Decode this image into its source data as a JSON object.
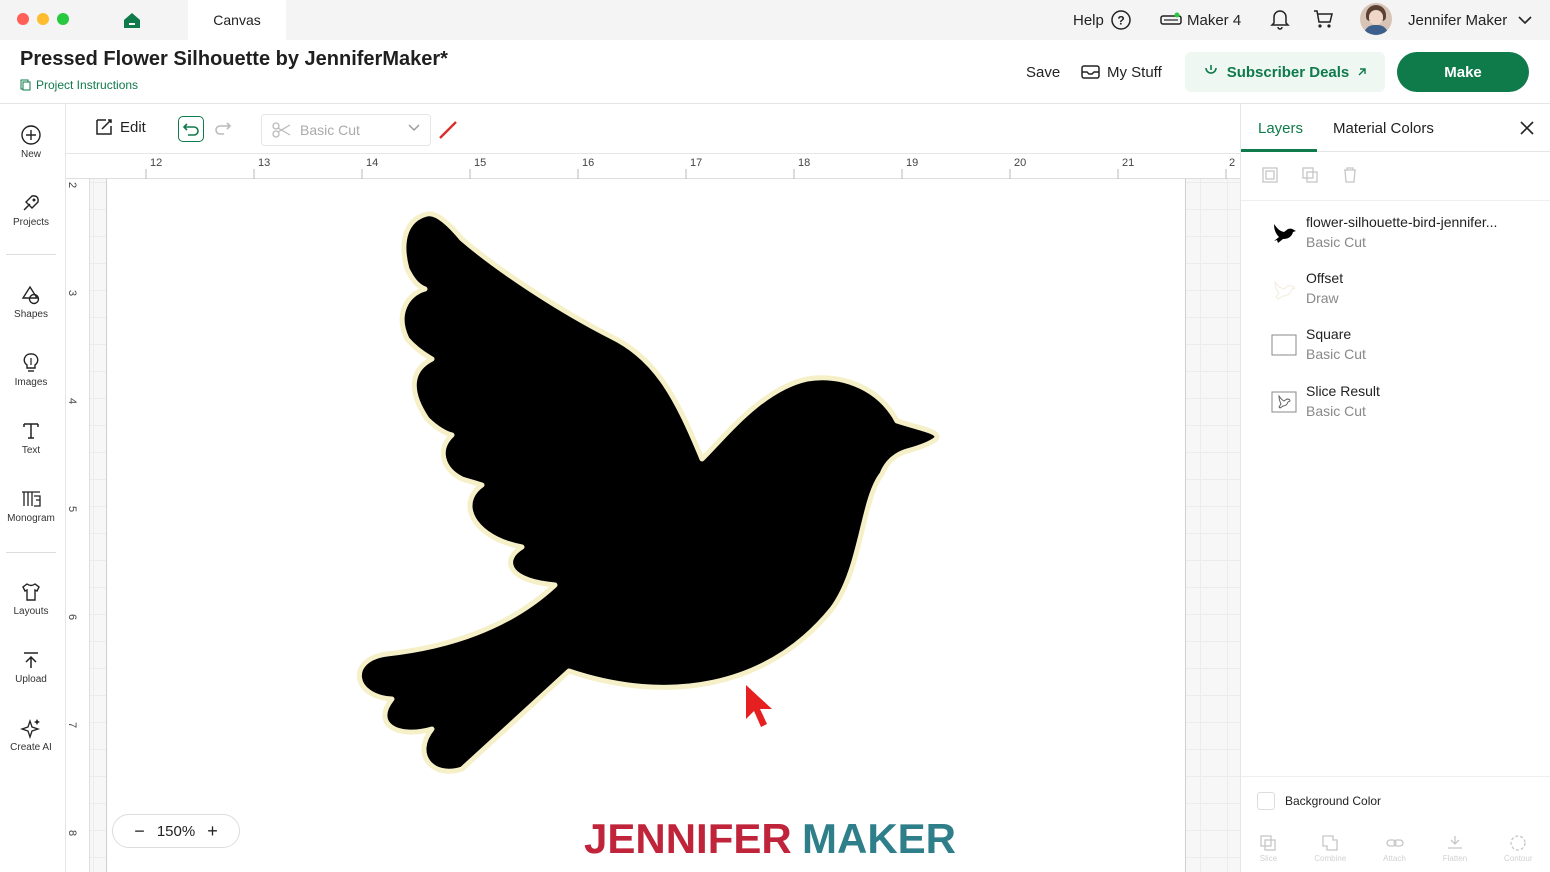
{
  "titlebar": {
    "tab_label": "Canvas",
    "help_label": "Help",
    "machine_label": "Maker 4",
    "user_name": "Jennifer Maker"
  },
  "header": {
    "project_title": "Pressed Flower Silhouette by JenniferMaker*",
    "instructions_link": "Project Instructions",
    "save_label": "Save",
    "mystuff_label": "My Stuff",
    "deals_label": "Subscriber Deals",
    "make_label": "Make"
  },
  "sidebar": {
    "items": [
      {
        "label": "New"
      },
      {
        "label": "Projects"
      },
      {
        "label": "Shapes"
      },
      {
        "label": "Images"
      },
      {
        "label": "Text"
      },
      {
        "label": "Monogram"
      },
      {
        "label": "Layouts"
      },
      {
        "label": "Upload"
      },
      {
        "label": "Create AI"
      }
    ]
  },
  "toolbar": {
    "edit_label": "Edit",
    "operation_value": "Basic Cut"
  },
  "canvas": {
    "ruler_top": [
      "12",
      "13",
      "14",
      "15",
      "16",
      "17",
      "18",
      "19",
      "20",
      "21",
      "2"
    ],
    "ruler_left": [
      "2",
      "3",
      "4",
      "5",
      "6",
      "7",
      "8"
    ],
    "zoom_value": "150%",
    "watermark": {
      "part1": "JENNIFER",
      "part2": "MAKER"
    }
  },
  "panel": {
    "tab_layers": "Layers",
    "tab_colors": "Material Colors",
    "layers": [
      {
        "name": "flower-silhouette-bird-jennifer...",
        "op": "Basic Cut"
      },
      {
        "name": "Offset",
        "op": "Draw"
      },
      {
        "name": "Square",
        "op": "Basic Cut"
      },
      {
        "name": "Slice Result",
        "op": "Basic Cut"
      }
    ],
    "background_color_label": "Background Color",
    "bottom_actions": [
      "Slice",
      "Combine",
      "Attach",
      "Flatten",
      "Contour"
    ]
  },
  "colors": {
    "brand_green": "#0f7a4a",
    "watermark_red": "#c0243a",
    "watermark_teal": "#2f7f8a",
    "cursor_red": "#e62020"
  }
}
